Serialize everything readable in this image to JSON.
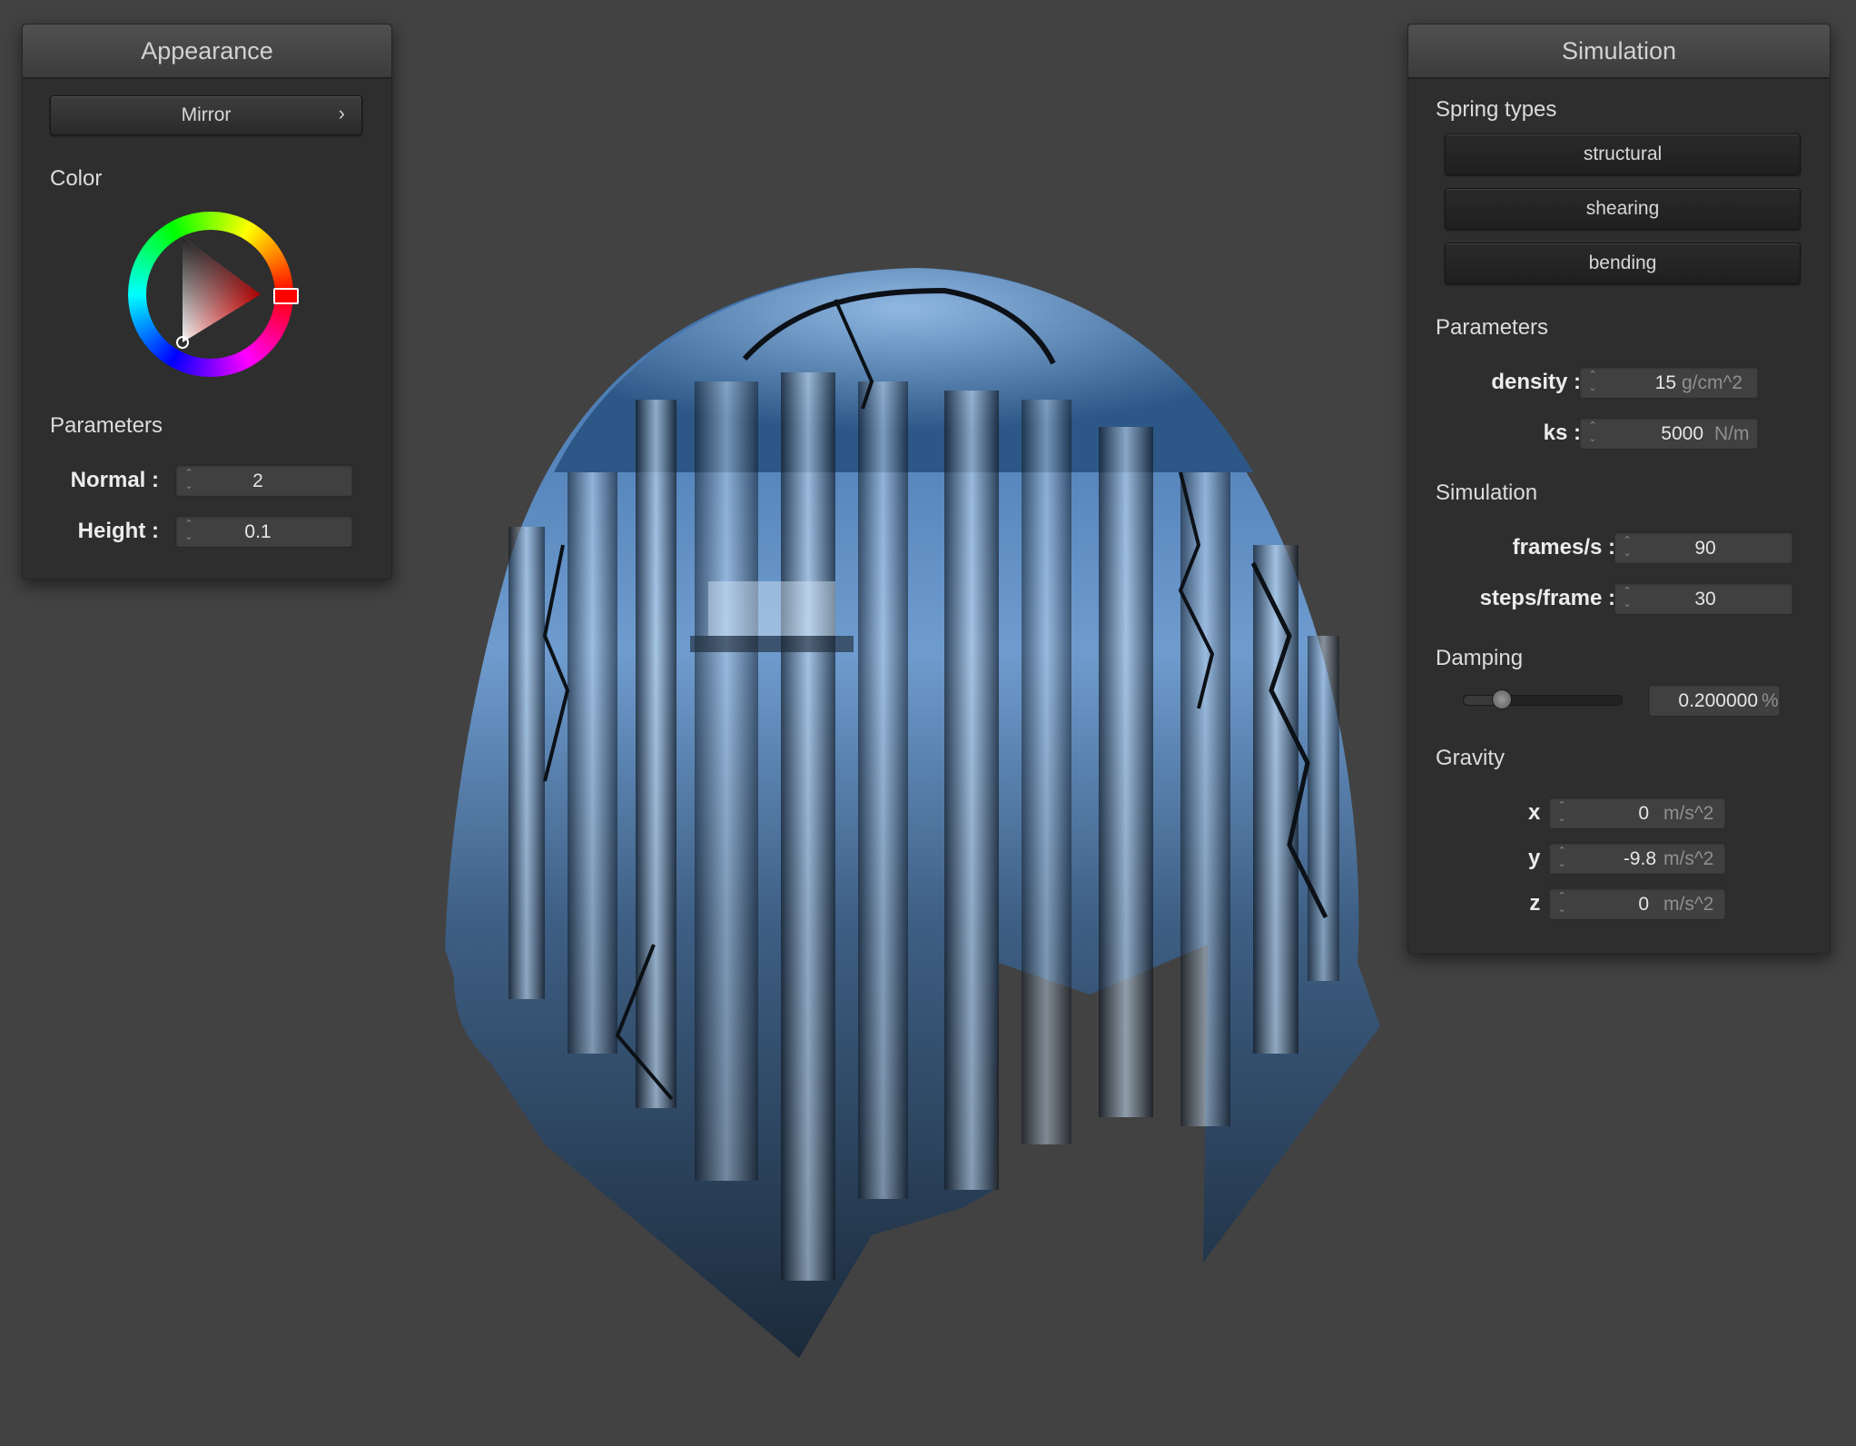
{
  "appearance": {
    "title": "Appearance",
    "material_button": "Mirror",
    "material_chevron": "›",
    "color_label": "Color",
    "parameters_label": "Parameters",
    "normal_label": "Normal :",
    "normal_value": "2",
    "height_label": "Height :",
    "height_value": "0.1",
    "selected_color": "#ff0000"
  },
  "simulation": {
    "title": "Simulation",
    "spring_types_label": "Spring types",
    "spring_buttons": [
      "structural",
      "shearing",
      "bending"
    ],
    "parameters_label": "Parameters",
    "density_label": "density :",
    "density_value": "15",
    "density_unit": "g/cm^2",
    "ks_label": "ks :",
    "ks_value": "5000",
    "ks_unit": "N/m",
    "simulation_label": "Simulation",
    "fps_label": "frames/s :",
    "fps_value": "90",
    "steps_label": "steps/frame :",
    "steps_value": "30",
    "damping_label": "Damping",
    "damping_value": "0.200000",
    "damping_unit": "%",
    "damping_fraction": 0.2,
    "gravity_label": "Gravity",
    "gx_label": "x :",
    "gx_value": "0",
    "gy_label": "y :",
    "gy_value": "-9.8",
    "gz_label": "z :",
    "gz_value": "0",
    "gravity_unit": "m/s^2"
  },
  "viewport": {
    "object": "mirror cloth draped over sphere",
    "background_color": "#424242"
  }
}
